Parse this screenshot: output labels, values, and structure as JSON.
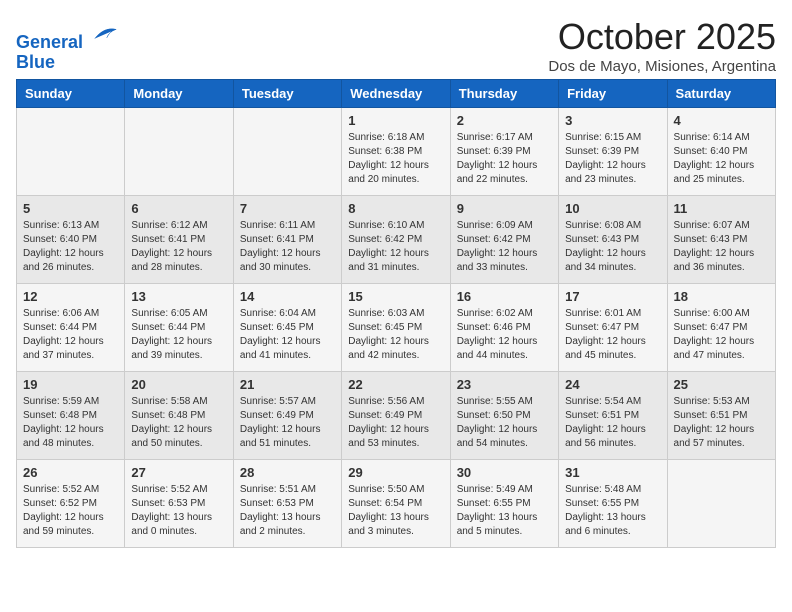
{
  "header": {
    "logo_line1": "General",
    "logo_line2": "Blue",
    "month": "October 2025",
    "location": "Dos de Mayo, Misiones, Argentina"
  },
  "weekdays": [
    "Sunday",
    "Monday",
    "Tuesday",
    "Wednesday",
    "Thursday",
    "Friday",
    "Saturday"
  ],
  "weeks": [
    [
      {
        "day": "",
        "info": ""
      },
      {
        "day": "",
        "info": ""
      },
      {
        "day": "",
        "info": ""
      },
      {
        "day": "1",
        "info": "Sunrise: 6:18 AM\nSunset: 6:38 PM\nDaylight: 12 hours\nand 20 minutes."
      },
      {
        "day": "2",
        "info": "Sunrise: 6:17 AM\nSunset: 6:39 PM\nDaylight: 12 hours\nand 22 minutes."
      },
      {
        "day": "3",
        "info": "Sunrise: 6:15 AM\nSunset: 6:39 PM\nDaylight: 12 hours\nand 23 minutes."
      },
      {
        "day": "4",
        "info": "Sunrise: 6:14 AM\nSunset: 6:40 PM\nDaylight: 12 hours\nand 25 minutes."
      }
    ],
    [
      {
        "day": "5",
        "info": "Sunrise: 6:13 AM\nSunset: 6:40 PM\nDaylight: 12 hours\nand 26 minutes."
      },
      {
        "day": "6",
        "info": "Sunrise: 6:12 AM\nSunset: 6:41 PM\nDaylight: 12 hours\nand 28 minutes."
      },
      {
        "day": "7",
        "info": "Sunrise: 6:11 AM\nSunset: 6:41 PM\nDaylight: 12 hours\nand 30 minutes."
      },
      {
        "day": "8",
        "info": "Sunrise: 6:10 AM\nSunset: 6:42 PM\nDaylight: 12 hours\nand 31 minutes."
      },
      {
        "day": "9",
        "info": "Sunrise: 6:09 AM\nSunset: 6:42 PM\nDaylight: 12 hours\nand 33 minutes."
      },
      {
        "day": "10",
        "info": "Sunrise: 6:08 AM\nSunset: 6:43 PM\nDaylight: 12 hours\nand 34 minutes."
      },
      {
        "day": "11",
        "info": "Sunrise: 6:07 AM\nSunset: 6:43 PM\nDaylight: 12 hours\nand 36 minutes."
      }
    ],
    [
      {
        "day": "12",
        "info": "Sunrise: 6:06 AM\nSunset: 6:44 PM\nDaylight: 12 hours\nand 37 minutes."
      },
      {
        "day": "13",
        "info": "Sunrise: 6:05 AM\nSunset: 6:44 PM\nDaylight: 12 hours\nand 39 minutes."
      },
      {
        "day": "14",
        "info": "Sunrise: 6:04 AM\nSunset: 6:45 PM\nDaylight: 12 hours\nand 41 minutes."
      },
      {
        "day": "15",
        "info": "Sunrise: 6:03 AM\nSunset: 6:45 PM\nDaylight: 12 hours\nand 42 minutes."
      },
      {
        "day": "16",
        "info": "Sunrise: 6:02 AM\nSunset: 6:46 PM\nDaylight: 12 hours\nand 44 minutes."
      },
      {
        "day": "17",
        "info": "Sunrise: 6:01 AM\nSunset: 6:47 PM\nDaylight: 12 hours\nand 45 minutes."
      },
      {
        "day": "18",
        "info": "Sunrise: 6:00 AM\nSunset: 6:47 PM\nDaylight: 12 hours\nand 47 minutes."
      }
    ],
    [
      {
        "day": "19",
        "info": "Sunrise: 5:59 AM\nSunset: 6:48 PM\nDaylight: 12 hours\nand 48 minutes."
      },
      {
        "day": "20",
        "info": "Sunrise: 5:58 AM\nSunset: 6:48 PM\nDaylight: 12 hours\nand 50 minutes."
      },
      {
        "day": "21",
        "info": "Sunrise: 5:57 AM\nSunset: 6:49 PM\nDaylight: 12 hours\nand 51 minutes."
      },
      {
        "day": "22",
        "info": "Sunrise: 5:56 AM\nSunset: 6:49 PM\nDaylight: 12 hours\nand 53 minutes."
      },
      {
        "day": "23",
        "info": "Sunrise: 5:55 AM\nSunset: 6:50 PM\nDaylight: 12 hours\nand 54 minutes."
      },
      {
        "day": "24",
        "info": "Sunrise: 5:54 AM\nSunset: 6:51 PM\nDaylight: 12 hours\nand 56 minutes."
      },
      {
        "day": "25",
        "info": "Sunrise: 5:53 AM\nSunset: 6:51 PM\nDaylight: 12 hours\nand 57 minutes."
      }
    ],
    [
      {
        "day": "26",
        "info": "Sunrise: 5:52 AM\nSunset: 6:52 PM\nDaylight: 12 hours\nand 59 minutes."
      },
      {
        "day": "27",
        "info": "Sunrise: 5:52 AM\nSunset: 6:53 PM\nDaylight: 13 hours\nand 0 minutes."
      },
      {
        "day": "28",
        "info": "Sunrise: 5:51 AM\nSunset: 6:53 PM\nDaylight: 13 hours\nand 2 minutes."
      },
      {
        "day": "29",
        "info": "Sunrise: 5:50 AM\nSunset: 6:54 PM\nDaylight: 13 hours\nand 3 minutes."
      },
      {
        "day": "30",
        "info": "Sunrise: 5:49 AM\nSunset: 6:55 PM\nDaylight: 13 hours\nand 5 minutes."
      },
      {
        "day": "31",
        "info": "Sunrise: 5:48 AM\nSunset: 6:55 PM\nDaylight: 13 hours\nand 6 minutes."
      },
      {
        "day": "",
        "info": ""
      }
    ]
  ]
}
